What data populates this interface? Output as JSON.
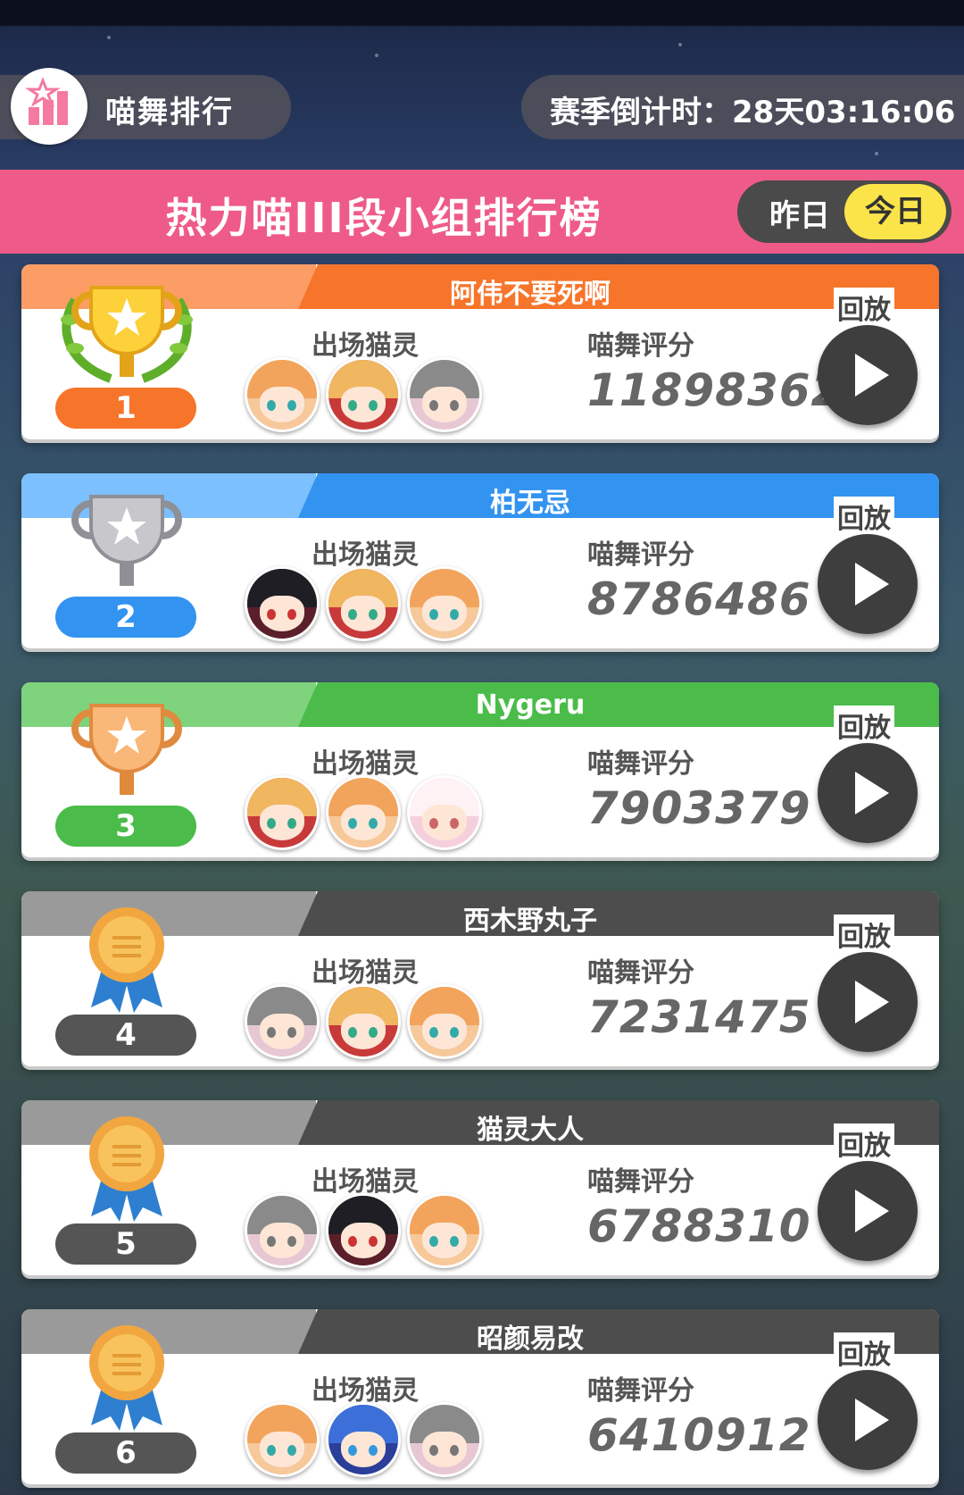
{
  "header": {
    "title": "喵舞排行",
    "season_countdown": "赛季倒计时：28天03:16:06"
  },
  "banner": {
    "title": "热力喵III段小组排行榜",
    "tab_yesterday": "昨日",
    "tab_today": "今日",
    "active_tab": "今日"
  },
  "labels": {
    "cats": "出场猫灵",
    "score": "喵舞评分",
    "replay": "回放"
  },
  "colors": {
    "pink_banner": "#ef5b88",
    "rank1": "#f7752b",
    "rank2": "#3393f0",
    "rank3": "#4bbc4a",
    "rank_other": "#555555",
    "toggle_active": "#fbe44a"
  },
  "rankings": [
    {
      "rank": "1",
      "name": "阿伟不要死啊",
      "score": "11898362",
      "badge": "gold-trophy-icon",
      "cats": [
        "orange-hair-cat",
        "blonde-red-cat",
        "gray-hair-cat"
      ]
    },
    {
      "rank": "2",
      "name": "柏无忌",
      "score": "8786486",
      "badge": "silver-trophy-icon",
      "cats": [
        "black-hair-cat",
        "blonde-red-cat",
        "orange-hair-cat"
      ]
    },
    {
      "rank": "3",
      "name": "Nygeru",
      "score": "7903379",
      "badge": "bronze-trophy-icon",
      "cats": [
        "blonde-red-cat",
        "orange-hair-cat",
        "pink-hat-cat"
      ]
    },
    {
      "rank": "4",
      "name": "西木野丸子",
      "score": "7231475",
      "badge": "ribbon-medal-icon",
      "cats": [
        "gray-hair-cat",
        "blonde-red-cat",
        "orange-hair-cat"
      ]
    },
    {
      "rank": "5",
      "name": "猫灵大人",
      "score": "6788310",
      "badge": "ribbon-medal-icon",
      "cats": [
        "gray-hair-cat",
        "black-hair-cat",
        "orange-hair-cat"
      ]
    },
    {
      "rank": "6",
      "name": "昭颜易改",
      "score": "6410912",
      "badge": "ribbon-medal-icon",
      "cats": [
        "orange-hair-cat",
        "blue-hair-cat",
        "gray-hair-cat"
      ]
    }
  ]
}
